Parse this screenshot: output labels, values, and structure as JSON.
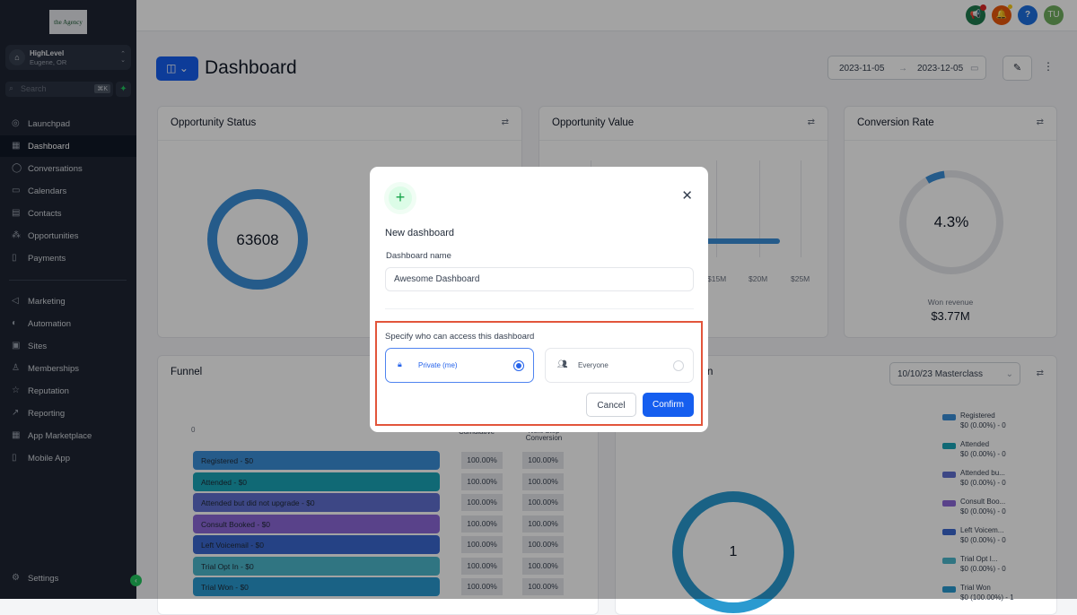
{
  "sidebar": {
    "logo": "The Agency",
    "account": {
      "name": "HighLevel",
      "location": "Eugene, OR"
    },
    "search": {
      "placeholder": "Search",
      "shortcut": "⌘K"
    },
    "items": [
      {
        "label": "Launchpad",
        "icon": "◎"
      },
      {
        "label": "Dashboard",
        "icon": "▦"
      },
      {
        "label": "Conversations",
        "icon": "◯"
      },
      {
        "label": "Calendars",
        "icon": "▭"
      },
      {
        "label": "Contacts",
        "icon": "▤"
      },
      {
        "label": "Opportunities",
        "icon": "⁂"
      },
      {
        "label": "Payments",
        "icon": "▯"
      }
    ],
    "items2": [
      {
        "label": "Marketing",
        "icon": "◁"
      },
      {
        "label": "Automation",
        "icon": "◐"
      },
      {
        "label": "Sites",
        "icon": "▣"
      },
      {
        "label": "Memberships",
        "icon": "♙"
      },
      {
        "label": "Reputation",
        "icon": "☆"
      },
      {
        "label": "Reporting",
        "icon": "↗"
      },
      {
        "label": "App Marketplace",
        "icon": "▦"
      },
      {
        "label": "Mobile App",
        "icon": "▯"
      }
    ],
    "settings": "Settings"
  },
  "topbar": {
    "avatar": "TU",
    "help": "?"
  },
  "header": {
    "title": "Dashboard",
    "start_date": "2023-11-05",
    "end_date": "2023-12-05"
  },
  "cards": {
    "status": {
      "title": "Opportunity Status",
      "value": "63608"
    },
    "value": {
      "title": "Opportunity Value",
      "ticks": [
        "$15M",
        "$20M",
        "$25M"
      ]
    },
    "conversion": {
      "title": "Conversion Rate",
      "value": "4.3%",
      "label": "Won revenue",
      "revenue": "$3.77M",
      "rate": 0.043
    },
    "funnel": {
      "title": "Funnel",
      "zero": "0",
      "col1": "Cumulative",
      "col2": "Next Step Conversion"
    },
    "right": {
      "title": "n",
      "select": "10/10/23 Masterclass",
      "center": "1"
    }
  },
  "funnel": [
    {
      "label": "Registered - $0",
      "color": "#3b8fd8",
      "c": "100.00%",
      "n": "100.00%"
    },
    {
      "label": "Attended - $0",
      "color": "#1aa5b8",
      "c": "100.00%",
      "n": "100.00%"
    },
    {
      "label": "Attended but did not upgrade - $0",
      "color": "#6070d0",
      "c": "100.00%",
      "n": "100.00%"
    },
    {
      "label": "Consult Booked - $0",
      "color": "#8b68d8",
      "c": "100.00%",
      "n": "100.00%"
    },
    {
      "label": "Left Voicemail - $0",
      "color": "#3b68d0",
      "c": "100.00%",
      "n": "100.00%"
    },
    {
      "label": "Trial Opt In - $0",
      "color": "#4cb8cc",
      "c": "100.00%",
      "n": "100.00%"
    },
    {
      "label": "Trial Won - $0",
      "color": "#2a9ad0",
      "c": "100.00%",
      "n": "100.00%"
    }
  ],
  "legend": [
    {
      "name": "Registered",
      "v": "$0 (0.00%) - 0",
      "color": "#3b8fd8"
    },
    {
      "name": "Attended",
      "v": "$0 (0.00%) - 0",
      "color": "#1aa5b8"
    },
    {
      "name": "Attended bu...",
      "v": "$0 (0.00%) - 0",
      "color": "#6070d0"
    },
    {
      "name": "Consult Boo...",
      "v": "$0 (0.00%) - 0",
      "color": "#8b68d8"
    },
    {
      "name": "Left Voicem...",
      "v": "$0 (0.00%) - 0",
      "color": "#3b68d0"
    },
    {
      "name": "Trial Opt I...",
      "v": "$0 (0.00%) - 0",
      "color": "#4cb8cc"
    },
    {
      "name": "Trial Won",
      "v": "$0 (100.00%) - 1",
      "color": "#2a9ad0"
    }
  ],
  "modal": {
    "title": "New dashboard",
    "name_label": "Dashboard name",
    "name_value": "Awesome Dashboard",
    "access_label": "Specify who can access this dashboard",
    "private": "Private (me)",
    "everyone": "Everyone",
    "cancel": "Cancel",
    "confirm": "Confirm",
    "selected": "private"
  }
}
